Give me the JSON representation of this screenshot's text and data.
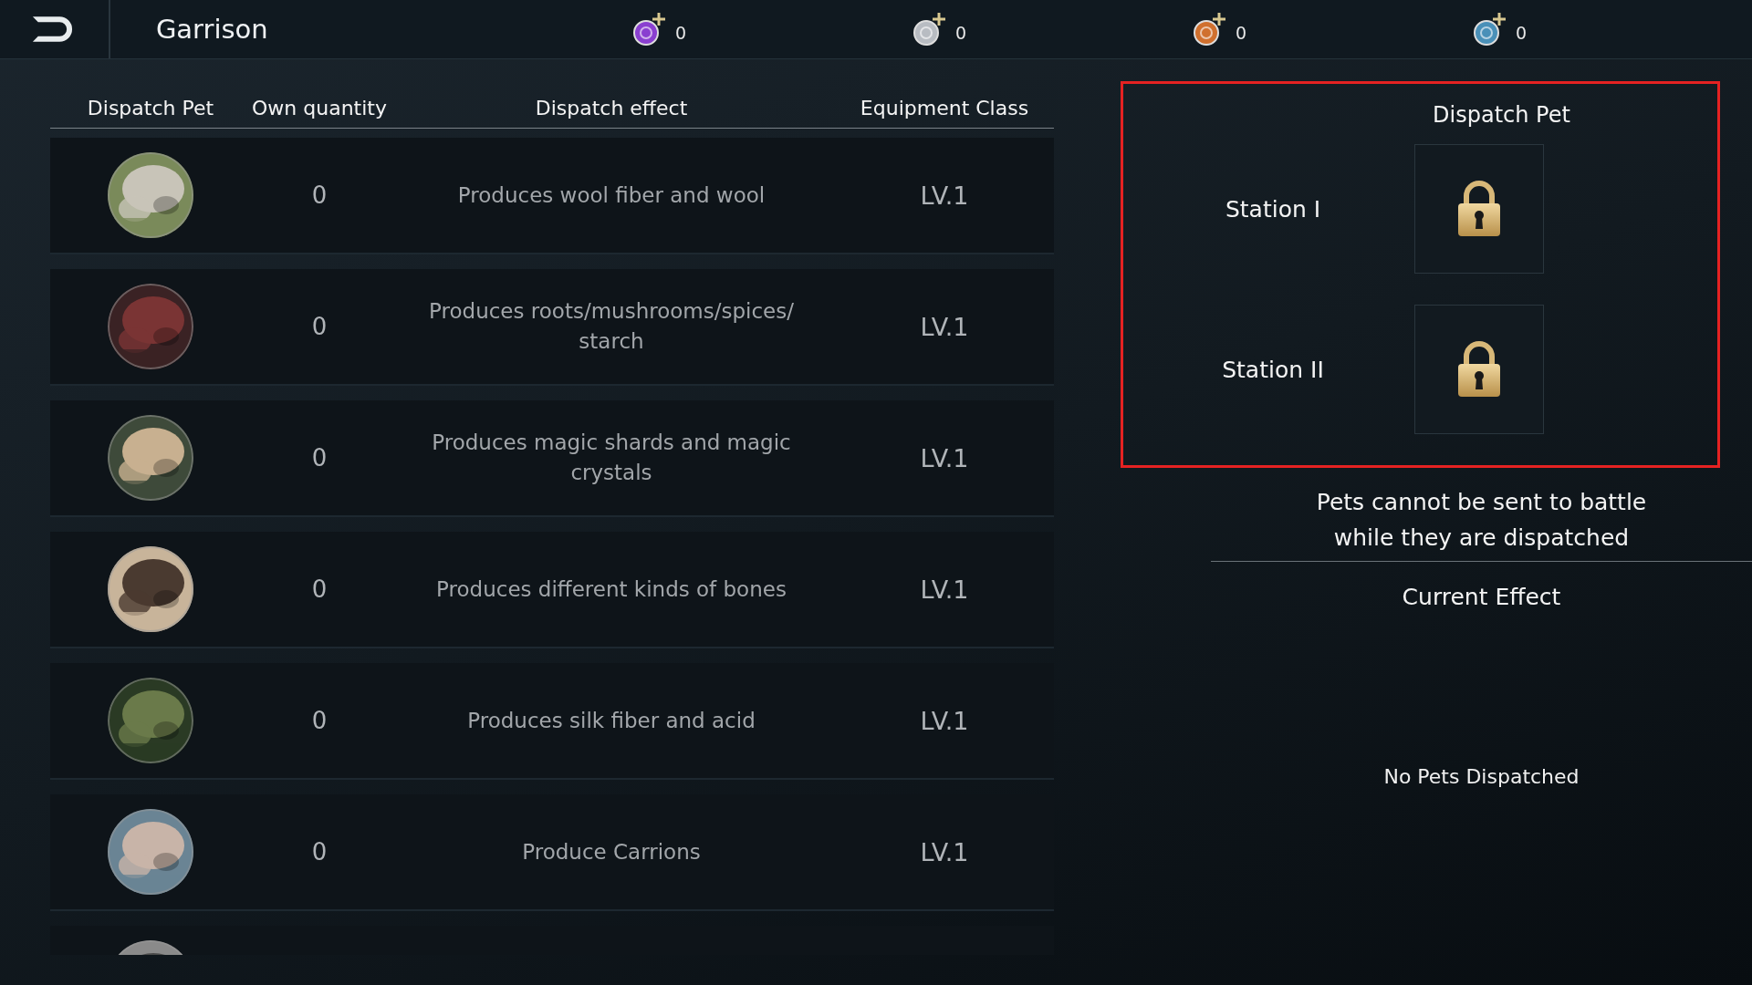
{
  "top_bar": {
    "title": "Garrison",
    "currencies": [
      {
        "color": "#8a3fd0",
        "count": "0"
      },
      {
        "color": "#b8bcc2",
        "count": "0"
      },
      {
        "color": "#d0702e",
        "count": "0"
      },
      {
        "color": "#4a90b8",
        "count": "0"
      }
    ]
  },
  "table": {
    "columns": [
      "Dispatch Pet",
      "Own quantity",
      "Dispatch effect",
      "Equipment Class"
    ],
    "rows": [
      {
        "portrait": {
          "kind": "picture"
        },
        "quantity": "0",
        "effect": "Produces wool fiber and wool",
        "class": "LV.1"
      },
      {
        "portrait": {
          "kind": "picture"
        },
        "quantity": "0",
        "effect": "Produces roots/mushrooms/spices/ starch",
        "class": "LV.1"
      },
      {
        "portrait": {
          "kind": "picture"
        },
        "quantity": "0",
        "effect": "Produces magic shards and magic crystals",
        "class": "LV.1"
      },
      {
        "portrait": {
          "kind": "picture"
        },
        "quantity": "0",
        "effect": "Produces different kinds of bones",
        "class": "LV.1"
      },
      {
        "portrait": {
          "kind": "picture"
        },
        "quantity": "0",
        "effect": "Produces silk fiber and acid",
        "class": "LV.1"
      },
      {
        "portrait": {
          "kind": "picture"
        },
        "quantity": "0",
        "effect": "Produce Carrions",
        "class": "LV.1"
      },
      {
        "portrait": {
          "kind": "picture"
        }
      }
    ]
  },
  "dispatch_panel": {
    "highlighted": true,
    "title": "Dispatch Pet",
    "stations": [
      {
        "label": "Station I",
        "locked": true
      },
      {
        "label": "Station II",
        "locked": true
      }
    ]
  },
  "note": "Pets cannot be sent to battle while they are dispatched",
  "current_effect": {
    "title": "Current Effect",
    "empty_text": "No Pets Dispatched"
  }
}
